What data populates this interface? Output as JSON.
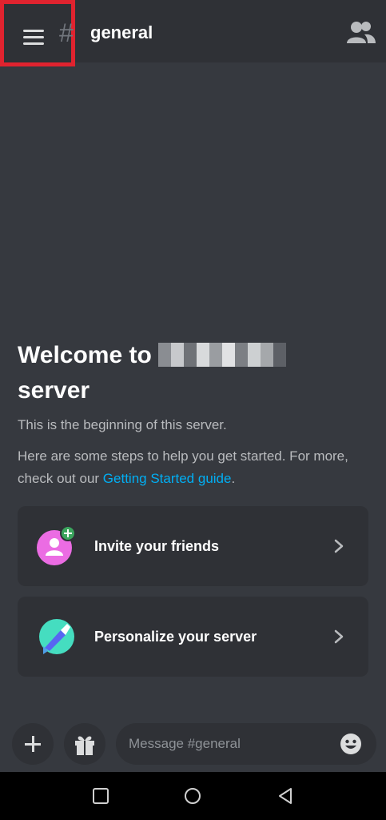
{
  "header": {
    "hash_symbol": "#",
    "channel_name": "general",
    "menu_icon": "hamburger-icon",
    "members_icon": "members-icon"
  },
  "welcome": {
    "title_prefix": "Welcome to",
    "title_suffix": "server",
    "subtitle": "This is the beginning of this server.",
    "steps_text": "Here are some steps to help you get started. For more, check out our",
    "link_text": "Getting Started guide",
    "link_suffix": "."
  },
  "cards": [
    {
      "label": "Invite your friends",
      "icon": "invite-friends-icon"
    },
    {
      "label": "Personalize your server",
      "icon": "personalize-server-icon"
    }
  ],
  "composer": {
    "placeholder": "Message #general",
    "add_icon": "plus-icon",
    "gift_icon": "gift-icon",
    "emoji_icon": "emoji-icon"
  },
  "colors": {
    "background": "#36393f",
    "surface": "#2f3136",
    "link": "#00aff4",
    "highlight_border": "#e0232f"
  }
}
